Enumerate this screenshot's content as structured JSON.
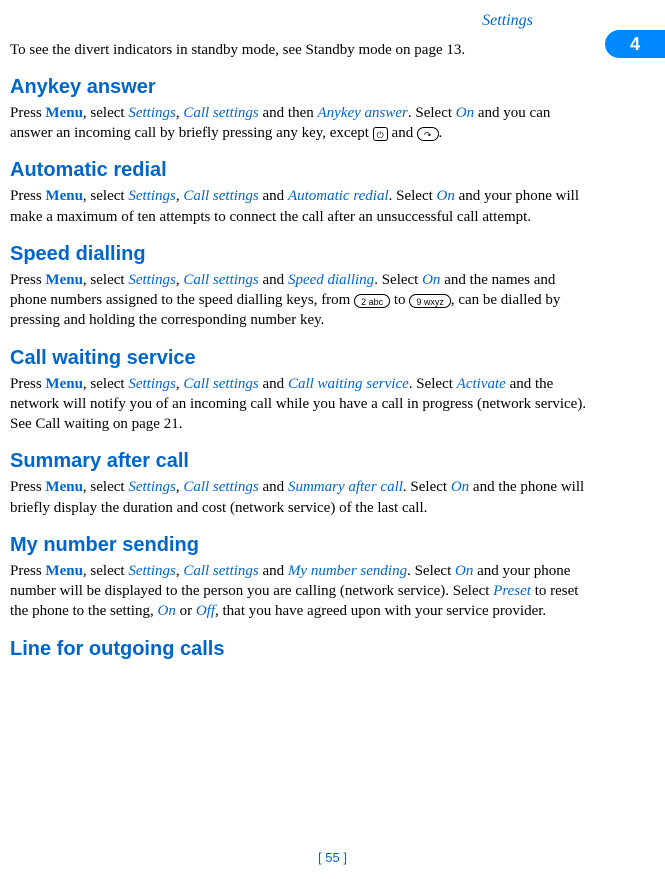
{
  "header": {
    "category": "Settings",
    "chapter": "4"
  },
  "intro": {
    "text_pre": "To see the divert indicators in standby mode, see Standby mode on page ",
    "page_ref": "13",
    "text_post": "."
  },
  "sections": {
    "anykey": {
      "heading": "Anykey answer",
      "p1_press": "Press ",
      "p1_menu": "Menu",
      "p1_sel": ", select ",
      "p1_settings": "Settings",
      "p1_c1": ", ",
      "p1_callsettings": "Call settings",
      "p1_andthen": " and then ",
      "p1_anykey": "Anykey answer",
      "p1_sel2": ". Select ",
      "p1_on": "On",
      "p1_rest1": " and you can answer an incoming call by briefly pressing any key, except ",
      "p1_key1": "⏻",
      "p1_and": " and ",
      "p1_key2": "↷",
      "p1_end": "."
    },
    "autoredial": {
      "heading": "Automatic redial",
      "p_press": "Press ",
      "p_menu": "Menu",
      "p_sel": ", select ",
      "p_settings": "Settings",
      "p_c1": ", ",
      "p_callsettings": "Call settings",
      "p_and": " and ",
      "p_feature": "Automatic redial",
      "p_sel2": ". Select ",
      "p_on": "On",
      "p_rest": " and your phone will make a maximum of ten attempts to connect the call after an unsuccessful call attempt."
    },
    "speeddial": {
      "heading": "Speed dialling",
      "p_press": "Press ",
      "p_menu": "Menu",
      "p_sel": ", select ",
      "p_settings": "Settings",
      "p_c1": ", ",
      "p_callsettings": "Call settings",
      "p_and": " and ",
      "p_feature": "Speed dialling",
      "p_sel2": ". Select ",
      "p_on": "On",
      "p_rest1": " and the names and phone numbers assigned to the speed dialling keys, from ",
      "p_key1": "2 abc",
      "p_to": " to ",
      "p_key2": "9 wxyz",
      "p_rest2": ", can be dialled by pressing and holding the corresponding number key."
    },
    "callwait": {
      "heading": "Call waiting service",
      "p_press": "Press ",
      "p_menu": "Menu",
      "p_sel": ", select ",
      "p_settings": "Settings",
      "p_c1": ", ",
      "p_callsettings": "Call settings",
      "p_and": " and ",
      "p_feature": "Call waiting service",
      "p_sel2": ". Select ",
      "p_activate": "Activate",
      "p_rest": " and the network will notify you of an incoming call while you have a call in progress (network service). See Call waiting on page 21."
    },
    "summary": {
      "heading": "Summary after call",
      "p_press": "Press ",
      "p_menu": "Menu",
      "p_sel": ", select ",
      "p_settings": "Settings",
      "p_c1": ", ",
      "p_callsettings": "Call settings",
      "p_and": " and ",
      "p_feature": "Summary after call",
      "p_sel2": ". Select ",
      "p_on": "On",
      "p_rest": " and the phone will briefly display the duration and cost (network service) of the last call."
    },
    "mynumber": {
      "heading": "My number sending",
      "p_press": "Press ",
      "p_menu": "Menu",
      "p_sel": ", select ",
      "p_settings": "Settings",
      "p_c1": ", ",
      "p_callsettings": "Call settings",
      "p_and": " and ",
      "p_feature": "My number sending",
      "p_sel2": ". Select ",
      "p_on": "On",
      "p_rest1": " and your phone number will be displayed to the person you are calling (network service). Select ",
      "p_preset": "Preset",
      "p_rest2": " to reset the phone to the setting, ",
      "p_on2": "On",
      "p_or": " or ",
      "p_off": "Off",
      "p_rest3": ", that you have agreed upon with your service provider."
    },
    "lineout": {
      "heading": "Line for outgoing calls"
    }
  },
  "footer": {
    "page": "[ 55 ]"
  }
}
